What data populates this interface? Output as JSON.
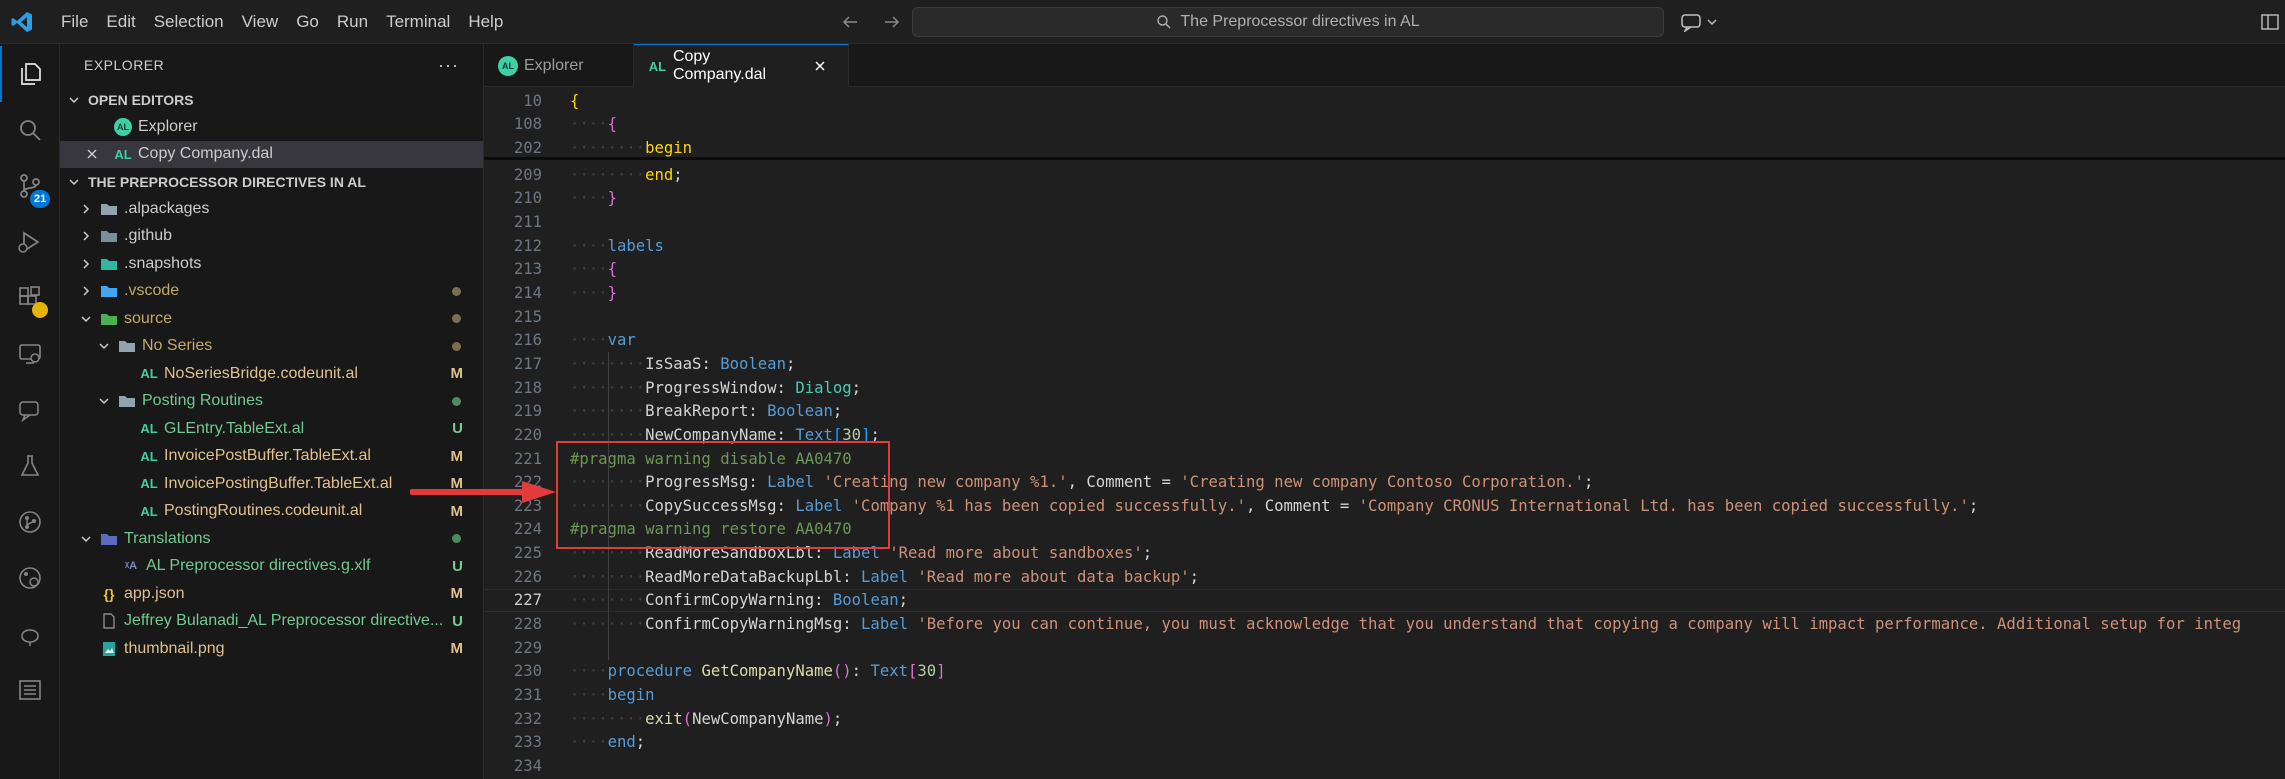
{
  "titlebar": {
    "menu": [
      "File",
      "Edit",
      "Selection",
      "View",
      "Go",
      "Run",
      "Terminal",
      "Help"
    ],
    "search_text": "The Preprocessor directives in AL"
  },
  "activity": {
    "source_control_badge": "21"
  },
  "sidebar": {
    "header": "EXPLORER",
    "open_editors_title": "OPEN EDITORS",
    "open_editors": [
      {
        "label": "Explorer",
        "icon": "al-round-icon"
      },
      {
        "label": "Copy Company.dal",
        "icon": "al-icon",
        "selected": true
      }
    ],
    "workspace_title": "THE PREPROCESSOR DIRECTIVES IN AL",
    "tree": [
      {
        "label": ".alpackages",
        "kind": "folder",
        "indent": 0,
        "expanded": false,
        "color": "default",
        "status": ""
      },
      {
        "label": ".github",
        "kind": "folder-github",
        "indent": 0,
        "expanded": false,
        "color": "default",
        "status": ""
      },
      {
        "label": ".snapshots",
        "kind": "folder-snap",
        "indent": 0,
        "expanded": false,
        "color": "default",
        "status": ""
      },
      {
        "label": ".vscode",
        "kind": "folder-vscode",
        "indent": 0,
        "expanded": false,
        "color": "olive",
        "status": "dot"
      },
      {
        "label": "source",
        "kind": "folder-source",
        "indent": 0,
        "expanded": true,
        "color": "olive",
        "status": "dot"
      },
      {
        "label": "No Series",
        "kind": "folder-plain",
        "indent": 1,
        "expanded": true,
        "color": "olive",
        "status": "dot"
      },
      {
        "label": "NoSeriesBridge.codeunit.al",
        "kind": "al",
        "indent": 2,
        "color": "yellow",
        "status": "M"
      },
      {
        "label": "Posting Routines",
        "kind": "folder-plain",
        "indent": 1,
        "expanded": true,
        "color": "green",
        "status": "dot-green"
      },
      {
        "label": "GLEntry.TableExt.al",
        "kind": "al",
        "indent": 2,
        "color": "green",
        "status": "U"
      },
      {
        "label": "InvoicePostBuffer.TableExt.al",
        "kind": "al",
        "indent": 2,
        "color": "yellow",
        "status": "M"
      },
      {
        "label": "InvoicePostingBuffer.TableExt.al",
        "kind": "al",
        "indent": 2,
        "color": "yellow",
        "status": "M"
      },
      {
        "label": "PostingRoutines.codeunit.al",
        "kind": "al",
        "indent": 2,
        "color": "yellow",
        "status": "M"
      },
      {
        "label": "Translations",
        "kind": "folder-trans",
        "indent": 0,
        "expanded": true,
        "color": "green",
        "status": "dot-green"
      },
      {
        "label": "AL Preprocessor directives.g.xlf",
        "kind": "xlf",
        "indent": 1,
        "color": "green",
        "status": "U"
      },
      {
        "label": "app.json",
        "kind": "json",
        "indent": 0,
        "color": "yellow",
        "status": "M"
      },
      {
        "label": "Jeffrey Bulanadi_AL Preprocessor directive...",
        "kind": "file",
        "indent": 0,
        "color": "green",
        "status": "U"
      },
      {
        "label": "thumbnail.png",
        "kind": "png",
        "indent": 0,
        "color": "yellow",
        "status": "M"
      }
    ]
  },
  "tabs": [
    {
      "label": "Explorer",
      "active": false
    },
    {
      "label": "Copy Company.dal",
      "active": true
    }
  ],
  "editor": {
    "lines": [
      {
        "n": "10",
        "indent": 0,
        "tokens": [
          [
            "{",
            "brace1"
          ]
        ]
      },
      {
        "n": "108",
        "indent": 1,
        "tokens": [
          [
            "{",
            "brace2"
          ]
        ]
      },
      {
        "n": "202",
        "indent": 2,
        "tokens": [
          [
            "begin",
            "brace1"
          ]
        ]
      },
      {
        "n": "209",
        "indent": 2,
        "tokens": [
          [
            "end",
            "brace1"
          ],
          [
            ";",
            "plain"
          ]
        ]
      },
      {
        "n": "210",
        "indent": 1,
        "tokens": [
          [
            "}",
            "brace2"
          ]
        ]
      },
      {
        "n": "211",
        "indent": 0,
        "tokens": []
      },
      {
        "n": "212",
        "indent": 1,
        "tokens": [
          [
            "labels",
            "kw"
          ]
        ]
      },
      {
        "n": "213",
        "indent": 1,
        "tokens": [
          [
            "{",
            "brace2"
          ]
        ]
      },
      {
        "n": "214",
        "indent": 1,
        "tokens": [
          [
            "}",
            "brace2"
          ]
        ]
      },
      {
        "n": "215",
        "indent": 0,
        "tokens": []
      },
      {
        "n": "216",
        "indent": 1,
        "tokens": [
          [
            "var",
            "kw"
          ]
        ]
      },
      {
        "n": "217",
        "indent": 2,
        "tokens": [
          [
            "IsSaaS",
            "plain"
          ],
          [
            ": ",
            "plain"
          ],
          [
            "Boolean",
            "kw"
          ],
          [
            ";",
            "plain"
          ]
        ]
      },
      {
        "n": "218",
        "indent": 2,
        "tokens": [
          [
            "ProgressWindow",
            "plain"
          ],
          [
            ": ",
            "plain"
          ],
          [
            "Dialog",
            "type"
          ],
          [
            ";",
            "plain"
          ]
        ]
      },
      {
        "n": "219",
        "indent": 2,
        "tokens": [
          [
            "BreakReport",
            "plain"
          ],
          [
            ": ",
            "plain"
          ],
          [
            "Boolean",
            "kw"
          ],
          [
            ";",
            "plain"
          ]
        ]
      },
      {
        "n": "220",
        "indent": 2,
        "tokens": [
          [
            "NewCompanyName",
            "plain"
          ],
          [
            ": ",
            "plain"
          ],
          [
            "Text",
            "kw"
          ],
          [
            "[",
            "brace3"
          ],
          [
            "30",
            "num"
          ],
          [
            "]",
            "brace3"
          ],
          [
            ";",
            "plain"
          ]
        ]
      },
      {
        "n": "221",
        "indent": 0,
        "tokens": [
          [
            "#pragma warning disable AA0470",
            "pragma"
          ]
        ]
      },
      {
        "n": "222",
        "indent": 2,
        "tokens": [
          [
            "ProgressMsg",
            "plain"
          ],
          [
            ": ",
            "plain"
          ],
          [
            "Label",
            "kw"
          ],
          [
            " ",
            "plain"
          ],
          [
            "'Creating new company %1.'",
            "str"
          ],
          [
            ", Comment = ",
            "plain"
          ],
          [
            "'Creating new company Contoso Corporation.'",
            "str"
          ],
          [
            ";",
            "plain"
          ]
        ]
      },
      {
        "n": "223",
        "indent": 2,
        "tokens": [
          [
            "CopySuccessMsg",
            "plain"
          ],
          [
            ": ",
            "plain"
          ],
          [
            "Label",
            "kw"
          ],
          [
            " ",
            "plain"
          ],
          [
            "'Company %1 has been copied successfully.'",
            "str"
          ],
          [
            ", Comment = ",
            "plain"
          ],
          [
            "'Company CRONUS International Ltd. has been copied successfully.'",
            "str"
          ],
          [
            ";",
            "plain"
          ]
        ]
      },
      {
        "n": "224",
        "indent": 0,
        "tokens": [
          [
            "#pragma warning restore AA0470",
            "pragma"
          ]
        ]
      },
      {
        "n": "225",
        "indent": 2,
        "tokens": [
          [
            "ReadMoreSandboxLbl",
            "plain"
          ],
          [
            ": ",
            "plain"
          ],
          [
            "Label",
            "kw"
          ],
          [
            " ",
            "plain"
          ],
          [
            "'Read more about sandboxes'",
            "str"
          ],
          [
            ";",
            "plain"
          ]
        ]
      },
      {
        "n": "226",
        "indent": 2,
        "tokens": [
          [
            "ReadMoreDataBackupLbl",
            "plain"
          ],
          [
            ": ",
            "plain"
          ],
          [
            "Label",
            "kw"
          ],
          [
            " ",
            "plain"
          ],
          [
            "'Read more about data backup'",
            "str"
          ],
          [
            ";",
            "plain"
          ]
        ]
      },
      {
        "n": "227",
        "indent": 2,
        "tokens": [
          [
            "ConfirmCopyWarning",
            "plain"
          ],
          [
            ": ",
            "plain"
          ],
          [
            "Boolean",
            "kw"
          ],
          [
            ";",
            "plain"
          ]
        ],
        "current": true
      },
      {
        "n": "228",
        "indent": 2,
        "tokens": [
          [
            "ConfirmCopyWarningMsg",
            "plain"
          ],
          [
            ": ",
            "plain"
          ],
          [
            "Label",
            "kw"
          ],
          [
            " ",
            "plain"
          ],
          [
            "'Before you can continue, you must acknowledge that you understand that copying a company will impact performance. Additional setup for integ",
            "str"
          ]
        ]
      },
      {
        "n": "229",
        "indent": 0,
        "tokens": []
      },
      {
        "n": "230",
        "indent": 1,
        "tokens": [
          [
            "procedure",
            "kw"
          ],
          [
            " ",
            "plain"
          ],
          [
            "GetCompanyName",
            "fn"
          ],
          [
            "()",
            "brace2"
          ],
          [
            ": ",
            "plain"
          ],
          [
            "Text",
            "kw"
          ],
          [
            "[",
            "brace2"
          ],
          [
            "30",
            "num"
          ],
          [
            "]",
            "brace2"
          ]
        ]
      },
      {
        "n": "231",
        "indent": 1,
        "tokens": [
          [
            "begin",
            "kw"
          ]
        ]
      },
      {
        "n": "232",
        "indent": 2,
        "tokens": [
          [
            "exit",
            "fn"
          ],
          [
            "(",
            "brace2"
          ],
          [
            "NewCompanyName",
            "plain"
          ],
          [
            ")",
            "brace2"
          ],
          [
            ";",
            "plain"
          ]
        ]
      },
      {
        "n": "233",
        "indent": 1,
        "tokens": [
          [
            "end",
            "kw"
          ],
          [
            ";",
            "plain"
          ]
        ]
      },
      {
        "n": "234",
        "indent": 0,
        "tokens": []
      }
    ]
  },
  "colors": {
    "accent": "#0078d4",
    "highlight_box": "#e23b3b"
  }
}
